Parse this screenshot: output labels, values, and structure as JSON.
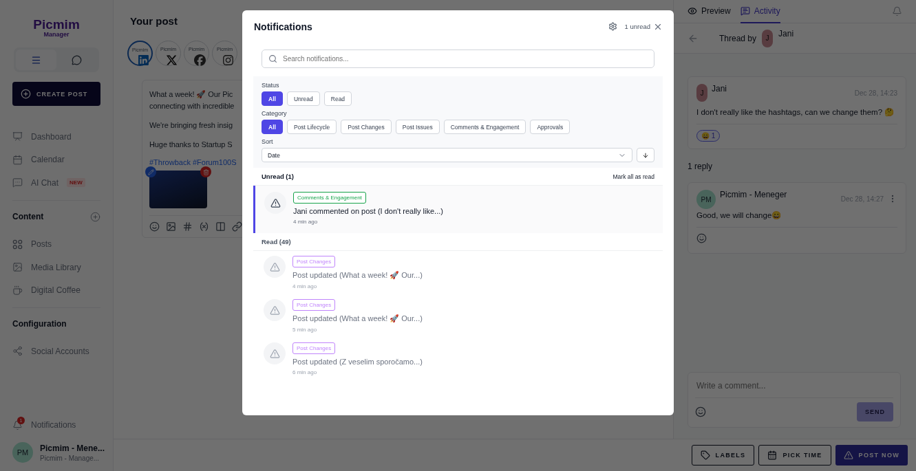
{
  "sidebar": {
    "logo": "Picmim",
    "logo_subtitle": "Manager",
    "view_toggle": [
      {
        "kind": "menu",
        "selected": true
      },
      {
        "kind": "chat",
        "selected": false
      }
    ],
    "create_post": "CREATE POST",
    "nav": [
      {
        "kind": "dashboard",
        "label": "Dashboard"
      },
      {
        "kind": "calendar",
        "label": "Calendar"
      },
      {
        "kind": "chat",
        "label": "AI Chat",
        "badge": "NEW"
      }
    ],
    "sections": [
      {
        "title": "Content",
        "add_button": true,
        "items": [
          {
            "kind": "posts",
            "label": "Posts"
          },
          {
            "kind": "media",
            "label": "Media Library"
          },
          {
            "kind": "coffee",
            "label": "Digital Coffee"
          }
        ]
      },
      {
        "title": "Configuration",
        "add_button": false,
        "items": [
          {
            "kind": "share",
            "label": "Social Accounts"
          }
        ]
      }
    ],
    "notifications": {
      "label": "Notifications",
      "count": "1"
    },
    "user": {
      "initials": "PM",
      "name": "Picmim - Mene...",
      "role": "Picmim - Manage..."
    }
  },
  "post_editor": {
    "title": "Your post",
    "accounts": [
      {
        "name": "Picmim",
        "kind": "linkedin",
        "selected": true
      },
      {
        "name": "Picmim",
        "kind": "x",
        "selected": false
      },
      {
        "name": "Picmim",
        "kind": "facebook",
        "selected": false
      },
      {
        "name": "Picmim",
        "kind": "instagram",
        "selected": false
      }
    ],
    "paragraphs": [
      [
        "What a week! 🚀 Our Pic",
        "connecting with incredible"
      ],
      [
        "We're bringing fresh insig"
      ],
      [
        "Huge thanks to Startup S"
      ]
    ],
    "hashtags": "#Throwback #Forum100S"
  },
  "right_panel": {
    "tabs": [
      {
        "kind": "preview",
        "label": "Preview",
        "selected": false
      },
      {
        "kind": "activity",
        "label": "Activity",
        "selected": true
      }
    ],
    "thread": {
      "label": "Thread by",
      "author_initial": "J",
      "author": "Jani"
    },
    "comment": {
      "initial": "J",
      "author": "Jani",
      "time": "Dec 28, 14:23",
      "text": "I don't really like the hashtags, can we change them? 🤔",
      "reactions": [
        {
          "emoji": "😄",
          "count": "1",
          "selected": true
        }
      ]
    },
    "replies_label": "1 reply",
    "replies": [
      {
        "initials": "PM",
        "author": "Picmim - Meneger",
        "time": "Dec 28, 14:27",
        "text": "Good, we will change😄"
      }
    ],
    "composer": {
      "placeholder": "Write a comment...",
      "send": "SEND",
      "disabled": true
    }
  },
  "bottom_bar": {
    "buttons": [
      {
        "kind": "labels",
        "label": "LABELS"
      },
      {
        "kind": "pick_time",
        "label": "PICK TIME"
      },
      {
        "kind": "post_now",
        "label": "POST NOW"
      }
    ]
  },
  "modal": {
    "title": "Notifications",
    "unread_count": "1 unread",
    "search": {
      "placeholder": "Search notifications..."
    },
    "filters": [
      {
        "label": "Status",
        "options": [
          {
            "label": "All",
            "selected": true
          },
          {
            "label": "Unread",
            "selected": false
          },
          {
            "label": "Read",
            "selected": false
          }
        ]
      },
      {
        "label": "Category",
        "options": [
          {
            "label": "All",
            "selected": true
          },
          {
            "label": "Post Lifecycle",
            "selected": false
          },
          {
            "label": "Post Changes",
            "selected": false
          },
          {
            "label": "Post Issues",
            "selected": false
          },
          {
            "label": "Comments & Engagement",
            "selected": false
          },
          {
            "label": "Approvals",
            "selected": false
          }
        ]
      }
    ],
    "sort": {
      "label": "Sort",
      "value": "Date"
    },
    "groups": [
      {
        "title": "Unread (1)",
        "action": "Mark all as read",
        "items": [
          {
            "unread": true,
            "category": "Comments & Engagement",
            "color": "#16a34a",
            "text": "Jani commented on post (I don't really like...)",
            "time": "4 min ago"
          }
        ]
      },
      {
        "title": "Read (49)",
        "items": [
          {
            "unread": false,
            "category": "Post Changes",
            "color": "#c084fc",
            "text": "Post updated (What a week! 🚀 Our...)",
            "time": "4 min ago"
          },
          {
            "unread": false,
            "category": "Post Changes",
            "color": "#c084fc",
            "text": "Post updated (What a week! 🚀 Our...)",
            "time": "5 min ago"
          },
          {
            "unread": false,
            "category": "Post Changes",
            "color": "#c084fc",
            "text": "Post updated (Z veselim sporočamo...)",
            "time": "6 min ago"
          }
        ]
      }
    ]
  }
}
